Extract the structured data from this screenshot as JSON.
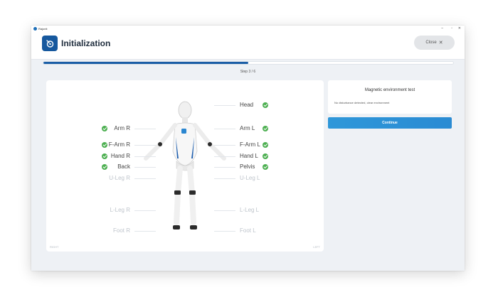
{
  "window": {
    "app_name": "Rajonit",
    "controls": {
      "minimize": "–",
      "maximize": "▫",
      "close": "✕"
    }
  },
  "header": {
    "title": "Initialization",
    "close_label": "Close",
    "close_icon": "close-icon"
  },
  "progress": {
    "fraction": 0.5,
    "step_text": "Step 3 / 6"
  },
  "sensors": {
    "right_side": [
      {
        "label": "Arm R",
        "ok": true
      },
      {
        "label": "F-Arm R",
        "ok": true
      },
      {
        "label": "Hand R",
        "ok": true
      },
      {
        "label": "Back",
        "ok": true
      },
      {
        "label": "U-Leg R",
        "ok": false
      },
      {
        "label": "L-Leg R",
        "ok": false
      },
      {
        "label": "Foot R",
        "ok": false
      }
    ],
    "left_side": [
      {
        "label": "Head",
        "ok": true
      },
      {
        "label": "Arm L",
        "ok": true
      },
      {
        "label": "F-Arm L",
        "ok": true
      },
      {
        "label": "Hand L",
        "ok": true
      },
      {
        "label": "Pelvis",
        "ok": true
      },
      {
        "label": "U-Leg L",
        "ok": false
      },
      {
        "label": "L-Leg L",
        "ok": false
      },
      {
        "label": "Foot L",
        "ok": false
      }
    ]
  },
  "corners": {
    "left": "RIGHT",
    "right": "LEFT"
  },
  "test_panel": {
    "title": "Magnetic environment test",
    "description": "No disturbance detected, clear environment"
  },
  "continue_label": "Continue",
  "colors": {
    "accent": "#1b5ea6",
    "ok": "#4caf50",
    "button": "#2e97d9"
  }
}
